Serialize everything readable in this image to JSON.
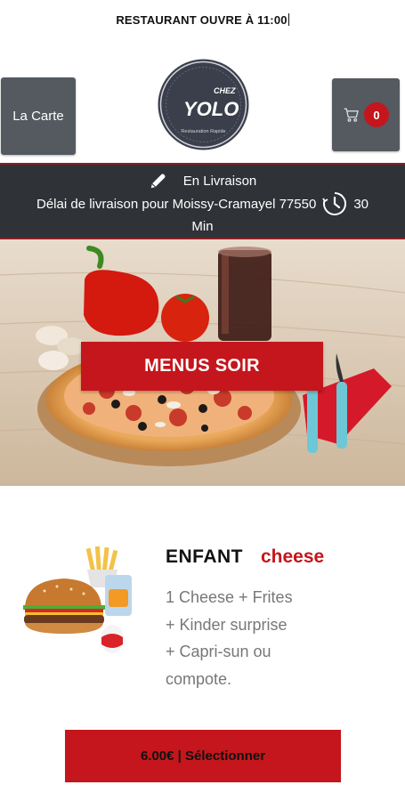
{
  "header": {
    "notice": "RESTAURANT OUVRE À 11:00",
    "menu_button": "La Carte",
    "cart_count": "0"
  },
  "logo": {
    "line1": "CHEZ",
    "line2": "YOLO",
    "tagline": "Restauration Rapide"
  },
  "delivery": {
    "mode": "En Livraison",
    "text": "Délai de livraison pour Moissy-Cramayel 77550",
    "time_value": "30",
    "time_unit": "Min"
  },
  "hero": {
    "button": "MENUS SOIR"
  },
  "product": {
    "name": "ENFANT",
    "variant": "cheese",
    "desc": [
      "1 Cheese + Frites",
      "+ Kinder surprise",
      "+ Capri-sun ou",
      "compote."
    ],
    "button": "6.00€ | Sélectionner"
  },
  "colors": {
    "accent": "#c4161c",
    "button_gray": "#545a60",
    "banner_bg": "#2f3237"
  }
}
